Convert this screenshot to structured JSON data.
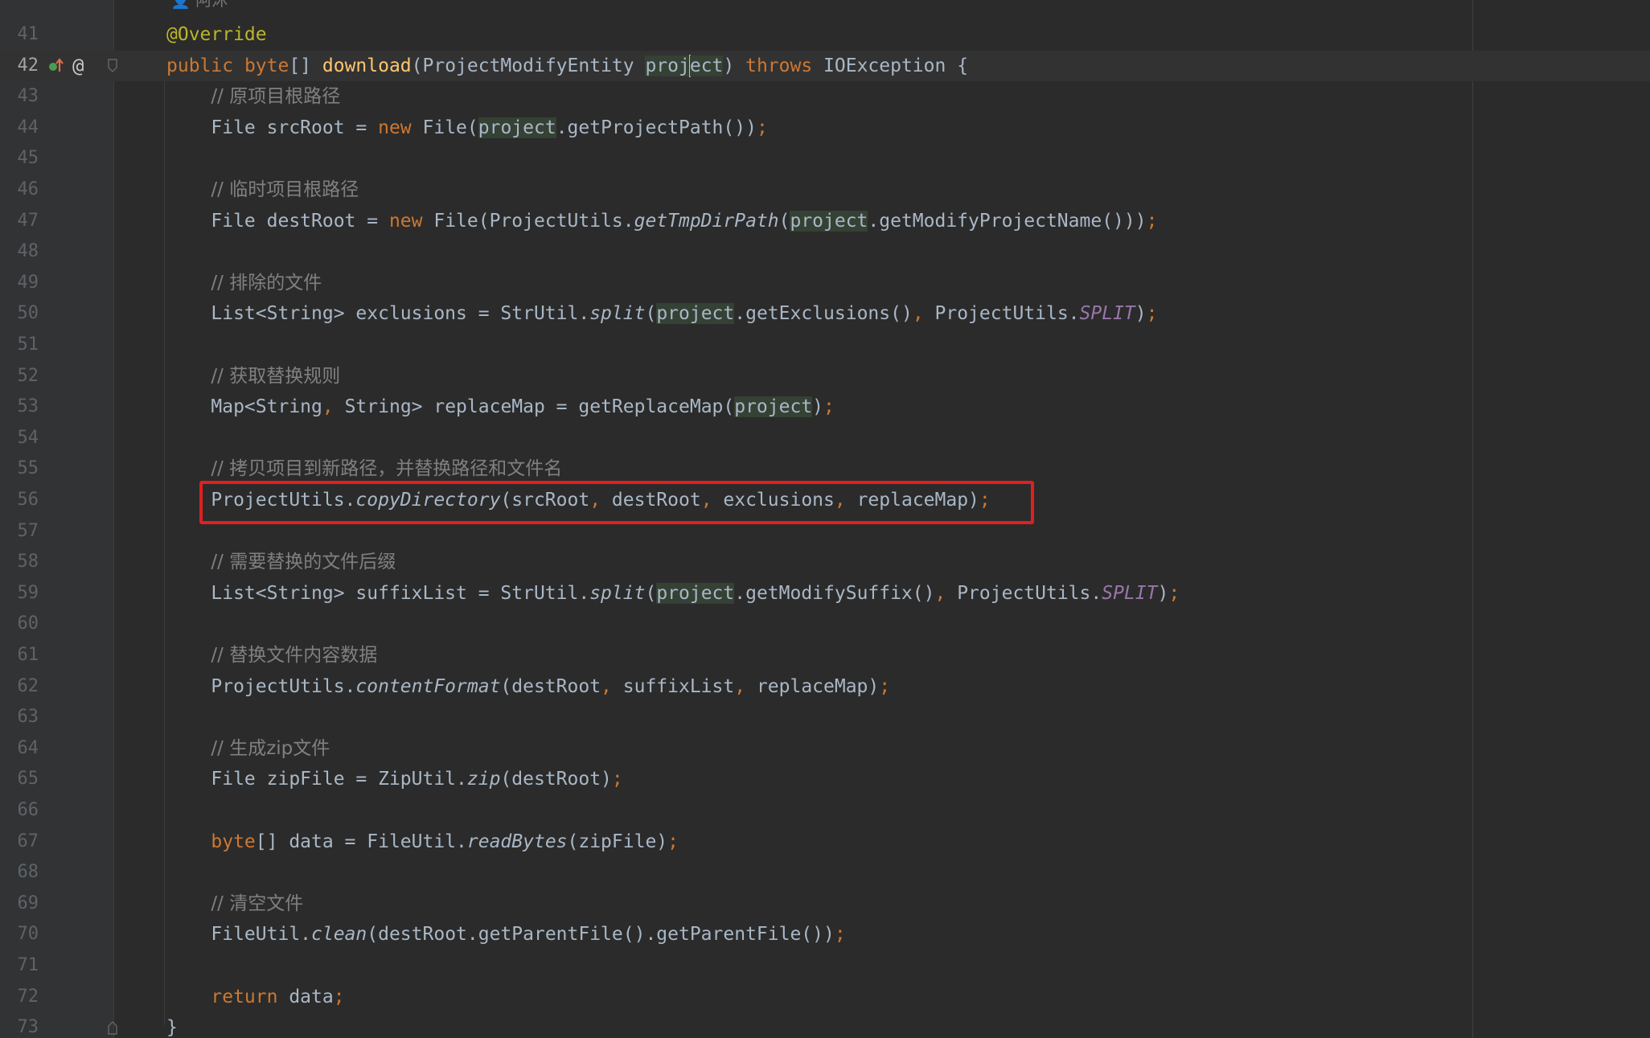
{
  "editor": {
    "author_hint": "阿沐",
    "lines": [
      {
        "n": "41",
        "tokens": [
          {
            "t": "@Override",
            "c": "ann"
          }
        ]
      },
      {
        "n": "42",
        "current": true,
        "tokens": [
          {
            "t": "public ",
            "c": "kw"
          },
          {
            "t": "byte",
            "c": "kw"
          },
          {
            "t": "[] "
          },
          {
            "t": "download",
            "c": "fn"
          },
          {
            "t": "(ProjectModifyEntity "
          },
          {
            "t": "proj",
            "c": "hl"
          },
          {
            "caret": true
          },
          {
            "t": "ect",
            "c": "hl"
          },
          {
            "t": ") "
          },
          {
            "t": "throws ",
            "c": "kw"
          },
          {
            "t": "IOException {"
          }
        ]
      },
      {
        "n": "43",
        "tokens": [
          {
            "t": "    "
          },
          {
            "t": "// ",
            "c": "cm"
          },
          {
            "t": "原项目根路径",
            "c": "cm"
          }
        ]
      },
      {
        "n": "44",
        "tokens": [
          {
            "t": "    File srcRoot = "
          },
          {
            "t": "new ",
            "c": "kw"
          },
          {
            "t": "File("
          },
          {
            "t": "project",
            "c": "hl"
          },
          {
            "t": ".getProjectPath())"
          },
          {
            "t": ";",
            "c": "kw"
          }
        ]
      },
      {
        "n": "45",
        "tokens": []
      },
      {
        "n": "46",
        "tokens": [
          {
            "t": "    "
          },
          {
            "t": "// ",
            "c": "cm"
          },
          {
            "t": "临时项目根路径",
            "c": "cm"
          }
        ]
      },
      {
        "n": "47",
        "tokens": [
          {
            "t": "    File destRoot = "
          },
          {
            "t": "new ",
            "c": "kw"
          },
          {
            "t": "File(ProjectUtils."
          },
          {
            "t": "getTmpDirPath",
            "c": "it"
          },
          {
            "t": "("
          },
          {
            "t": "project",
            "c": "hl"
          },
          {
            "t": ".getModifyProjectName()))"
          },
          {
            "t": ";",
            "c": "kw"
          }
        ]
      },
      {
        "n": "48",
        "tokens": []
      },
      {
        "n": "49",
        "tokens": [
          {
            "t": "    "
          },
          {
            "t": "// ",
            "c": "cm"
          },
          {
            "t": "排除的文件",
            "c": "cm"
          }
        ]
      },
      {
        "n": "50",
        "tokens": [
          {
            "t": "    List<String> exclusions = StrUtil."
          },
          {
            "t": "split",
            "c": "it"
          },
          {
            "t": "("
          },
          {
            "t": "project",
            "c": "hl"
          },
          {
            "t": ".getExclusions()"
          },
          {
            "t": ", ",
            "c": "kw"
          },
          {
            "t": "ProjectUtils."
          },
          {
            "t": "SPLIT",
            "c": "const"
          },
          {
            "t": ")"
          },
          {
            "t": ";",
            "c": "kw"
          }
        ]
      },
      {
        "n": "51",
        "tokens": []
      },
      {
        "n": "52",
        "tokens": [
          {
            "t": "    "
          },
          {
            "t": "// ",
            "c": "cm"
          },
          {
            "t": "获取替换规则",
            "c": "cm"
          }
        ]
      },
      {
        "n": "53",
        "tokens": [
          {
            "t": "    Map<String"
          },
          {
            "t": ", ",
            "c": "kw"
          },
          {
            "t": "String> replaceMap = getReplaceMap("
          },
          {
            "t": "project",
            "c": "hl"
          },
          {
            "t": ")"
          },
          {
            "t": ";",
            "c": "kw"
          }
        ]
      },
      {
        "n": "54",
        "tokens": []
      },
      {
        "n": "55",
        "tokens": [
          {
            "t": "    "
          },
          {
            "t": "// ",
            "c": "cm"
          },
          {
            "t": "拷贝项目到新路径，并替换路径和文件名",
            "c": "cm"
          }
        ]
      },
      {
        "n": "56",
        "tokens": [
          {
            "t": "    ProjectUtils."
          },
          {
            "t": "copyDirectory",
            "c": "it"
          },
          {
            "t": "(srcRoot"
          },
          {
            "t": ", ",
            "c": "kw"
          },
          {
            "t": "destRoot"
          },
          {
            "t": ", ",
            "c": "kw"
          },
          {
            "t": "exclusions"
          },
          {
            "t": ", ",
            "c": "kw"
          },
          {
            "t": "replaceMap)"
          },
          {
            "t": ";",
            "c": "kw"
          }
        ]
      },
      {
        "n": "57",
        "tokens": []
      },
      {
        "n": "58",
        "tokens": [
          {
            "t": "    "
          },
          {
            "t": "// ",
            "c": "cm"
          },
          {
            "t": "需要替换的文件后缀",
            "c": "cm"
          }
        ]
      },
      {
        "n": "59",
        "tokens": [
          {
            "t": "    List<String> suffixList = StrUtil."
          },
          {
            "t": "split",
            "c": "it"
          },
          {
            "t": "("
          },
          {
            "t": "project",
            "c": "hl"
          },
          {
            "t": ".getModifySuffix()"
          },
          {
            "t": ", ",
            "c": "kw"
          },
          {
            "t": "ProjectUtils."
          },
          {
            "t": "SPLIT",
            "c": "const"
          },
          {
            "t": ")"
          },
          {
            "t": ";",
            "c": "kw"
          }
        ]
      },
      {
        "n": "60",
        "tokens": []
      },
      {
        "n": "61",
        "tokens": [
          {
            "t": "    "
          },
          {
            "t": "// ",
            "c": "cm"
          },
          {
            "t": "替换文件内容数据",
            "c": "cm"
          }
        ]
      },
      {
        "n": "62",
        "tokens": [
          {
            "t": "    ProjectUtils."
          },
          {
            "t": "contentFormat",
            "c": "it"
          },
          {
            "t": "(destRoot"
          },
          {
            "t": ", ",
            "c": "kw"
          },
          {
            "t": "suffixList"
          },
          {
            "t": ", ",
            "c": "kw"
          },
          {
            "t": "replaceMap)"
          },
          {
            "t": ";",
            "c": "kw"
          }
        ]
      },
      {
        "n": "63",
        "tokens": []
      },
      {
        "n": "64",
        "tokens": [
          {
            "t": "    "
          },
          {
            "t": "// ",
            "c": "cm"
          },
          {
            "t": "生成zip文件",
            "c": "cm"
          }
        ]
      },
      {
        "n": "65",
        "tokens": [
          {
            "t": "    File zipFile = ZipUtil."
          },
          {
            "t": "zip",
            "c": "it"
          },
          {
            "t": "(destRoot)"
          },
          {
            "t": ";",
            "c": "kw"
          }
        ]
      },
      {
        "n": "66",
        "tokens": []
      },
      {
        "n": "67",
        "tokens": [
          {
            "t": "    "
          },
          {
            "t": "byte",
            "c": "kw"
          },
          {
            "t": "[] data = FileUtil."
          },
          {
            "t": "readBytes",
            "c": "it"
          },
          {
            "t": "(zipFile)"
          },
          {
            "t": ";",
            "c": "kw"
          }
        ]
      },
      {
        "n": "68",
        "tokens": []
      },
      {
        "n": "69",
        "tokens": [
          {
            "t": "    "
          },
          {
            "t": "// ",
            "c": "cm"
          },
          {
            "t": "清空文件",
            "c": "cm"
          }
        ]
      },
      {
        "n": "70",
        "tokens": [
          {
            "t": "    FileUtil."
          },
          {
            "t": "clean",
            "c": "it"
          },
          {
            "t": "(destRoot.getParentFile().getParentFile())"
          },
          {
            "t": ";",
            "c": "kw"
          }
        ]
      },
      {
        "n": "71",
        "tokens": []
      },
      {
        "n": "72",
        "tokens": [
          {
            "t": "    "
          },
          {
            "t": "return ",
            "c": "kw"
          },
          {
            "t": "data"
          },
          {
            "t": ";",
            "c": "kw"
          }
        ]
      },
      {
        "n": "73",
        "tokens": [
          {
            "t": "}"
          }
        ]
      }
    ]
  },
  "colors": {
    "background": "#2b2b2b",
    "gutter": "#313335",
    "keyword": "#cc7832",
    "annotation": "#bbb529",
    "method_decl": "#ffc66d",
    "comment": "#808080",
    "constant": "#9876aa",
    "default_text": "#a9b7c6",
    "usage_highlight": "#344134",
    "callout_box": "#e02020"
  },
  "icons": {
    "gutter_line_42": [
      "override-up-arrow-icon",
      "at-symbol-icon"
    ],
    "fold_markers": [
      "fold-start-icon",
      "fold-end-icon"
    ]
  }
}
